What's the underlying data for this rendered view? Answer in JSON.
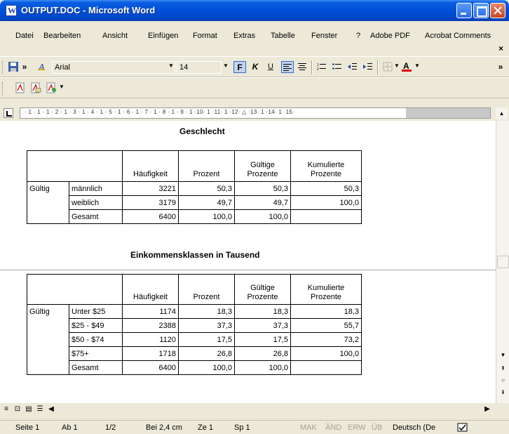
{
  "window": {
    "title": "OUTPUT.DOC - Microsoft Word"
  },
  "menu": {
    "items": [
      "Datei",
      "Bearbeiten",
      "Ansicht",
      "Einfügen",
      "Format",
      "Extras",
      "Tabelle",
      "Fenster",
      "?",
      "Adobe PDF",
      "Acrobat Comments"
    ],
    "close": "×"
  },
  "toolbar": {
    "font_name": "Arial",
    "font_size": "14",
    "bold_label": "F",
    "italic_label": "K",
    "underline_label": "U",
    "chevron": "»"
  },
  "ruler": {
    "ticks": "· 1 · 1 · 1 · 2 · 1 · 3 · 1 · 4 · 1 · 5 · 1 · 6 · 1 · 7 · 1 · 8 · 1 · 9 · 1 ·10· 1 ·11· 1 ·12· △ ·13· 1 ·14· 1 ·15·"
  },
  "tables": [
    {
      "title": "Geschlecht",
      "headers": [
        "Häufigkeit",
        "Prozent",
        "Gültige Prozente",
        "Kumulierte Prozente"
      ],
      "group_label": "Gültig",
      "rows": [
        {
          "label": "männlich",
          "cells": [
            "3221",
            "50,3",
            "50,3",
            "50,3"
          ]
        },
        {
          "label": "weiblich",
          "cells": [
            "3179",
            "49,7",
            "49,7",
            "100,0"
          ]
        },
        {
          "label": "Gesamt",
          "cells": [
            "6400",
            "100,0",
            "100,0",
            ""
          ]
        }
      ]
    },
    {
      "title": "Einkommensklassen in Tausend",
      "headers": [
        "Häufigkeit",
        "Prozent",
        "Gültige Prozente",
        "Kumulierte Prozente"
      ],
      "group_label": "Gültig",
      "rows": [
        {
          "label": "Unter $25",
          "cells": [
            "1174",
            "18,3",
            "18,3",
            "18,3"
          ]
        },
        {
          "label": "$25 - $49",
          "cells": [
            "2388",
            "37,3",
            "37,3",
            "55,7"
          ]
        },
        {
          "label": "$50 - $74",
          "cells": [
            "1120",
            "17,5",
            "17,5",
            "73,2"
          ]
        },
        {
          "label": "$75+",
          "cells": [
            "1718",
            "26,8",
            "26,8",
            "100,0"
          ]
        },
        {
          "label": "Gesamt",
          "cells": [
            "6400",
            "100,0",
            "100,0",
            ""
          ]
        }
      ]
    }
  ],
  "status": {
    "page": "Seite 1",
    "section": "Ab 1",
    "pages": "1/2",
    "position": "Bei 2,4 cm",
    "line": "Ze 1",
    "column": "Sp 1",
    "mak": "MAK",
    "and": "ÄND",
    "erw": "ERW",
    "ub": "ÜB",
    "language": "Deutsch (De"
  }
}
